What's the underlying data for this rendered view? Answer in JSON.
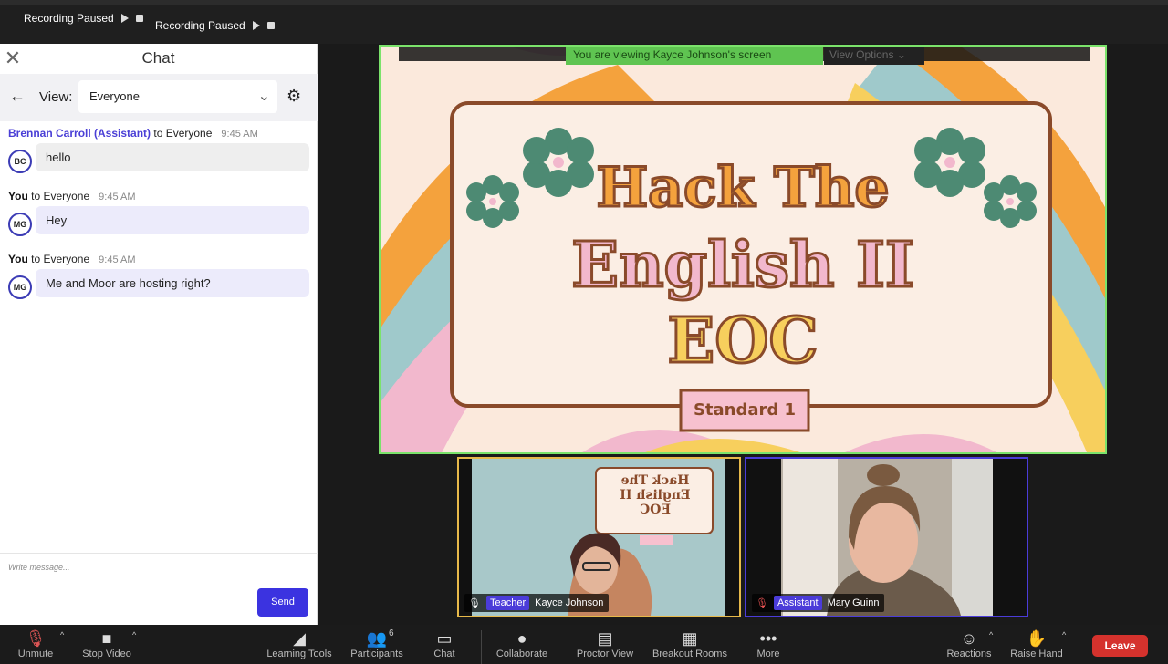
{
  "topbar": {
    "recording_label": "Recording Paused",
    "recording_label2": "Recording Paused"
  },
  "chat": {
    "title": "Chat",
    "view_label": "View:",
    "view_value": "Everyone",
    "messages": [
      {
        "sender": "Brennan Carroll (Assistant)",
        "to": " to Everyone",
        "time": "9:45 AM",
        "initials": "BC",
        "text": "hello"
      },
      {
        "sender": "You",
        "to": " to Everyone",
        "time": "9:45 AM",
        "initials": "MG",
        "text": "Hey"
      },
      {
        "sender": "You",
        "to": " to Everyone",
        "time": "9:45 AM",
        "initials": "MG",
        "text": "Me and Moor are hosting right?"
      }
    ],
    "composer_placeholder": "Write message...",
    "send_label": "Send"
  },
  "share": {
    "viewing_text": "You are viewing Kayce Johnson's screen",
    "view_options": "View Options",
    "slide_title_line1": "Hack The",
    "slide_title_line2": "English II",
    "slide_title_line3": "EOC",
    "slide_subtitle": "Standard 1"
  },
  "tiles": [
    {
      "role": "Teacher",
      "name": "Kayce Johnson"
    },
    {
      "role": "Assistant",
      "name": "Mary Guinn"
    }
  ],
  "toolbar": {
    "unmute": "Unmute",
    "stop_video": "Stop Video",
    "learning_tools": "Learning Tools",
    "participants": "Participants",
    "participants_count": "6",
    "chat": "Chat",
    "collaborate": "Collaborate",
    "proctor_view": "Proctor View",
    "breakout_rooms": "Breakout Rooms",
    "more": "More",
    "reactions": "Reactions",
    "raise_hand": "Raise Hand",
    "leave": "Leave"
  },
  "colors": {
    "accent": "#3b33e0",
    "leave": "#d5322d",
    "share_border": "#7be36b",
    "teacher_border": "#e7b94a",
    "assistant_border": "#4b3cd9"
  }
}
